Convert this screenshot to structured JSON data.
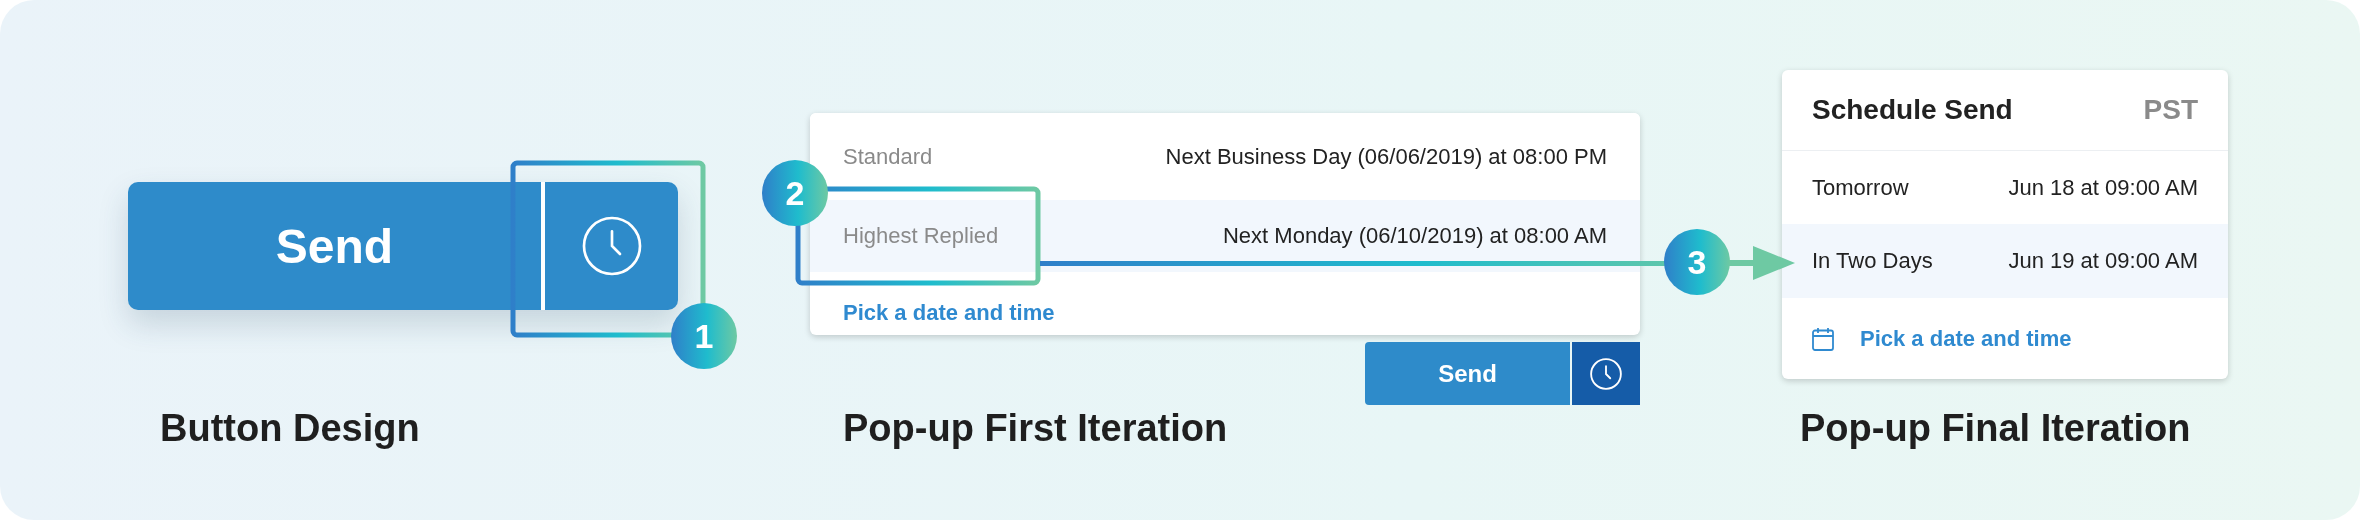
{
  "sections": [
    {
      "kind": "button",
      "title": "Button Design",
      "button": {
        "label": "Send"
      }
    },
    {
      "kind": "list_popup",
      "title": "Pop-up First Iteration",
      "options": [
        {
          "label": "Standard",
          "time": "Next Business Day (06/06/2019) at 08:00 PM",
          "selected": false
        },
        {
          "label": "Highest Replied",
          "time": "Next Monday (06/10/2019) at 08:00 AM",
          "selected": true
        }
      ],
      "link": "Pick a date and time",
      "button": {
        "label": "Send"
      }
    },
    {
      "kind": "schedule_popup",
      "title": "Pop-up Final Iteration",
      "header": "Schedule Send",
      "timezone": "PST",
      "options": [
        {
          "label": "Tomorrow",
          "time": "Jun 18 at 09:00 AM",
          "selected": false
        },
        {
          "label": "In Two Days",
          "time": "Jun 19 at 09:00 AM",
          "selected": true
        }
      ],
      "link": "Pick a date and time"
    }
  ],
  "callouts": [
    {
      "number": "1"
    },
    {
      "number": "2"
    },
    {
      "number": "3"
    }
  ]
}
